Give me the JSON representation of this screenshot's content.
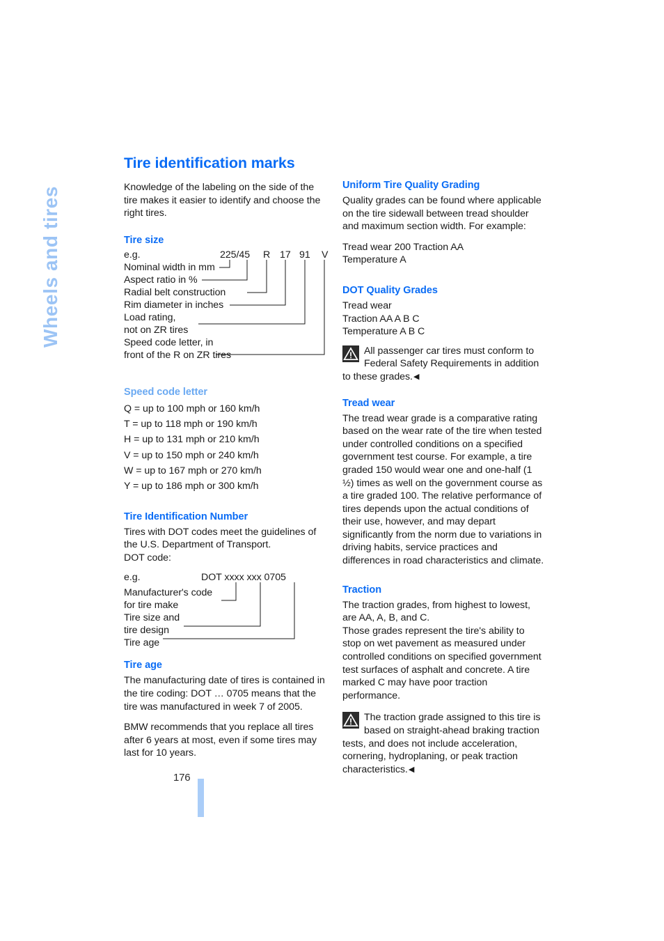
{
  "chapter_tab": {
    "label": "Wheels and tires"
  },
  "page_number": "176",
  "colors": {
    "heading_blue": "#0a6cf5",
    "heading_blue_light": "#6aa9f2",
    "chapter_tab_blue": "#9cc4f5",
    "footer_tab_blue": "#aacdf8"
  },
  "left_column": {
    "title": "Tire identification marks",
    "intro": "Knowledge of the labeling on the side of the tire makes it easier to identify and choose the right tires.",
    "tire_size": {
      "heading": "Tire size",
      "eg_label": "e.g.",
      "code": {
        "nominal_aspect": "225/45",
        "construction": "R",
        "rim": "17",
        "load": "91",
        "speed": "V"
      },
      "callouts": [
        "Nominal width in mm",
        "Aspect ratio in %",
        "Radial belt construction",
        "Rim diameter in inches",
        "Load rating,",
        "not on ZR tires",
        "Speed code letter, in",
        "front of the R on ZR tires"
      ]
    },
    "speed_code": {
      "heading": "Speed code letter",
      "entries": [
        "Q = up to 100 mph or 160 km/h",
        "T = up to 118 mph or 190 km/h",
        "H = up to 131 mph or 210 km/h",
        "V = up to 150 mph or 240 km/h",
        "W = up to 167 mph or 270 km/h",
        "Y = up to 186 mph or 300 km/h"
      ]
    },
    "tin": {
      "heading": "Tire Identification Number",
      "body": "Tires with DOT codes meet the guidelines of the U.S. Department of Transport.",
      "dot_code_label": "DOT code:",
      "eg_label": "e.g.",
      "code": "DOT xxxx xxx 0705",
      "callouts": [
        "Manufacturer's code",
        "for tire make",
        "Tire size and",
        "tire design",
        "Tire age"
      ]
    },
    "tire_age": {
      "heading": "Tire age",
      "para1": "The manufacturing date of tires is contained in the tire coding: DOT … 0705 means that the tire was manufactured in week 7 of 2005.",
      "para2": "BMW recommends that you replace all tires after 6 years at most, even if some tires may last for 10 years."
    }
  },
  "right_column": {
    "utqg": {
      "heading": "Uniform Tire Quality Grading",
      "body": "Quality grades can be found where applicable on the tire sidewall between tread shoulder and maximum section width. For example:",
      "example_lines": [
        "Tread wear 200 Traction AA",
        "Temperature A"
      ]
    },
    "dot_grades": {
      "heading": "DOT Quality Grades",
      "lines": [
        "Tread wear",
        "Traction AA A B C",
        "Temperature A B C"
      ],
      "note": "All passenger car tires must conform to Federal Safety Requirements in addition to these grades.",
      "note_end_arrow": "◀"
    },
    "tread_wear": {
      "heading": "Tread wear",
      "body": "The tread wear grade is a comparative rating based on the wear rate of the tire when tested under controlled conditions on a specified government test course. For example, a tire graded 150 would wear one and one-half (1 ½) times as well on the government course as a tire graded 100. The relative performance of tires depends upon the actual conditions of their use, however, and may depart significantly from the norm due to variations in driving habits, service practices and differences in road characteristics and climate."
    },
    "traction": {
      "heading": "Traction",
      "body1": "The traction grades, from highest to lowest, are AA, A, B, and C.",
      "body2": "Those grades represent the tire's ability to stop on wet pavement as measured under controlled conditions on specified government test surfaces of asphalt and concrete. A tire marked C may have poor traction performance.",
      "note": "The traction grade assigned to this tire is based on straight-ahead braking traction tests, and does not include acceleration, cornering, hydroplaning, or peak traction characteristics.",
      "note_end_arrow": "◀"
    }
  },
  "icons": {
    "warning": "warning-triangle-icon"
  }
}
